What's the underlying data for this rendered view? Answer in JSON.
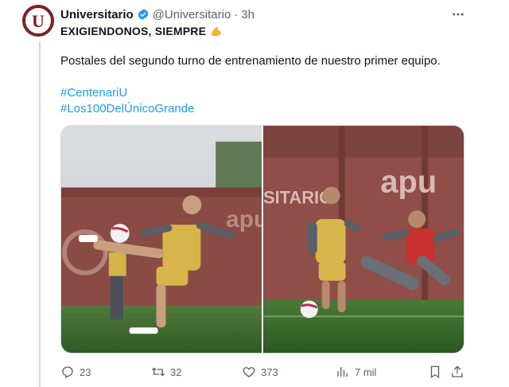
{
  "author": {
    "name": "Universitario",
    "handle": "@Universitario",
    "separator": "·",
    "time": "3h",
    "avatar_letter": "U"
  },
  "tweet": {
    "headline": "EXIGIENDONOS, SIEMPRE",
    "emoji": "flexed-biceps-emoji",
    "text": "Postales del segundo turno de entrenamiento de nuestro primer equipo.",
    "hashtags": [
      "#CentenariU",
      "#Los100DelÚnicoGrande"
    ]
  },
  "media": {
    "photo1_wall_text": "apu",
    "photo2_wall_text_left": "SITARIO",
    "photo2_wall_text_right": "apu"
  },
  "actions": {
    "replies": "23",
    "retweets": "32",
    "likes": "373",
    "views": "7 mil"
  },
  "icons": {
    "verified": "verified-badge-icon",
    "more": "more-options-icon",
    "reply": "reply-icon",
    "retweet": "retweet-icon",
    "like": "heart-icon",
    "views": "views-chart-icon",
    "bookmark": "bookmark-icon",
    "share": "share-icon"
  },
  "colors": {
    "link": "#1d9bf0",
    "muted": "#536471",
    "brand": "#7a1a1f"
  }
}
